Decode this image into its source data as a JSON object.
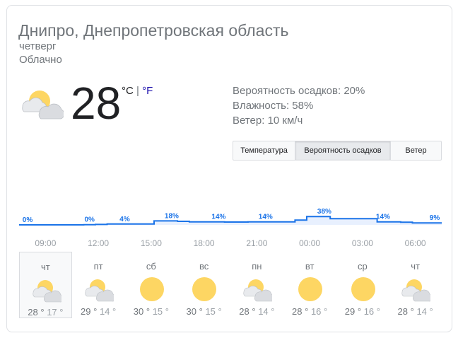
{
  "location": "Днипро, Днепропетровская область",
  "day": "четверг",
  "condition": "Облачно",
  "current": {
    "temp": "28",
    "unit_c": "°C",
    "unit_sep": " | ",
    "unit_f": "°F",
    "icon": "partly-cloudy-icon"
  },
  "details": {
    "precip": "Вероятность осадков: 20%",
    "humidity": "Влажность: 58%",
    "wind": "Ветер: 10 км/ч"
  },
  "tabs": [
    "Температура",
    "Вероятность осадков",
    "Ветер"
  ],
  "selected_tab": "Вероятность осадков",
  "chart_data": {
    "type": "area",
    "series_color": "#1a73e8",
    "fill_color": "#e8f0fe",
    "values": [
      0,
      0,
      0,
      0,
      0,
      0,
      1,
      2,
      4,
      4,
      4,
      4,
      18,
      18,
      16,
      14,
      14,
      14,
      13,
      13,
      14,
      14,
      14,
      14,
      22,
      38,
      38,
      28,
      28,
      28,
      28,
      14,
      14,
      12,
      9,
      9,
      9
    ],
    "labels": [
      {
        "i": 0,
        "text": "0%"
      },
      {
        "i": 6,
        "text": "0%"
      },
      {
        "i": 9,
        "text": "4%"
      },
      {
        "i": 13,
        "text": "18%"
      },
      {
        "i": 17,
        "text": "14%"
      },
      {
        "i": 21,
        "text": "14%"
      },
      {
        "i": 26,
        "text": "38%"
      },
      {
        "i": 31,
        "text": "14%"
      },
      {
        "i": 36,
        "text": "9%"
      }
    ],
    "ticks": [
      "09:00",
      "12:00",
      "15:00",
      "18:00",
      "21:00",
      "00:00",
      "03:00",
      "06:00"
    ],
    "ylim": [
      0,
      100
    ]
  },
  "forecast": [
    {
      "day": "чт",
      "icon": "partly-cloudy-icon",
      "hi": "28 °",
      "lo": "17 °",
      "selected": true
    },
    {
      "day": "пт",
      "icon": "partly-cloudy-icon",
      "hi": "29 °",
      "lo": "14 °"
    },
    {
      "day": "сб",
      "icon": "sun-icon",
      "hi": "30 °",
      "lo": "15 °"
    },
    {
      "day": "вс",
      "icon": "sun-icon",
      "hi": "30 °",
      "lo": "15 °"
    },
    {
      "day": "пн",
      "icon": "partly-cloudy-icon",
      "hi": "28 °",
      "lo": "14 °"
    },
    {
      "day": "вт",
      "icon": "sun-icon",
      "hi": "28 °",
      "lo": "16 °"
    },
    {
      "day": "ср",
      "icon": "sun-icon",
      "hi": "29 °",
      "lo": "16 °"
    },
    {
      "day": "чт",
      "icon": "partly-cloudy-icon",
      "hi": "28 °",
      "lo": "14 °"
    }
  ]
}
